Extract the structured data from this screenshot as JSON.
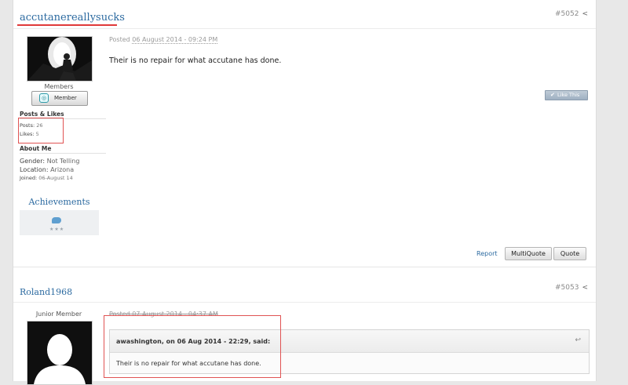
{
  "colors": {
    "link": "#2c6aa0",
    "highlight": "#e03a3a",
    "like_button": "#a9b8c8"
  },
  "post1": {
    "author": "accutanereallysucks",
    "post_number": "#5052",
    "share_icon": "share-icon",
    "group": "Members",
    "badge_label": "Member",
    "posts_likes_heading": "Posts & Likes",
    "posts_label": "Posts:",
    "posts_value": "26",
    "likes_label": "Likes:",
    "likes_value": "5",
    "about_heading": "About Me",
    "gender_label": "Gender:",
    "gender_value": "Not Telling",
    "location_label": "Location:",
    "location_value": "Arizona",
    "joined_label": "Joined:",
    "joined_value": "06-August 14",
    "achievements_title": "Achievements",
    "posted_prefix": "Posted",
    "posted_date": "06 August 2014 - 09:24 PM",
    "body": "Their is no repair for what accutane has done.",
    "like_label": "Like This",
    "report_label": "Report",
    "multiquote_label": "MultiQuote",
    "quote_label": "Quote"
  },
  "post2": {
    "author": "Roland1968",
    "post_number": "#5053",
    "group": "Junior Member",
    "posted_text": "Posted 07 August 2014 - 04:37 AM",
    "quote_author": "awashington, on 06 Aug 2014 - 22:29, said:",
    "quote_body": "Their is no repair for what accutane has done."
  }
}
